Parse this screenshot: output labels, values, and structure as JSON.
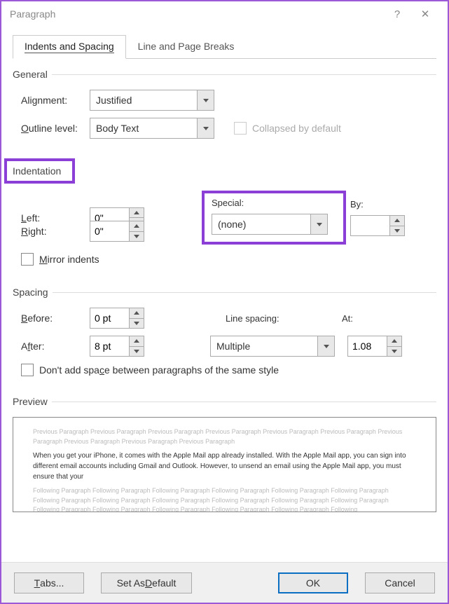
{
  "titlebar": {
    "title": "Paragraph",
    "help": "?",
    "close": "✕"
  },
  "tabs": {
    "t1": "Indents and Spacing",
    "t2": "Line and Page Breaks"
  },
  "general": {
    "title": "General",
    "alignment_label": "Alignment:",
    "alignment_value": "Justified",
    "outline_label": "Outline level:",
    "outline_value": "Body Text",
    "collapsed_label": "Collapsed by default"
  },
  "indentation": {
    "title": "Indentation",
    "left_label": "Left:",
    "left_value": "0\"",
    "right_label": "Right:",
    "right_value": "0\"",
    "special_label": "Special:",
    "special_value": "(none)",
    "by_label": "By:",
    "by_value": "",
    "mirror_label": "Mirror indents"
  },
  "spacing": {
    "title": "Spacing",
    "before_label": "Before:",
    "before_value": "0 pt",
    "after_label": "After:",
    "after_value": "8 pt",
    "line_label": "Line spacing:",
    "line_value": "Multiple",
    "at_label": "At:",
    "at_value": "1.08",
    "dont_add_label": "Don't add space between paragraphs of the same style"
  },
  "preview": {
    "title": "Preview",
    "prev_text": "Previous Paragraph Previous Paragraph Previous Paragraph Previous Paragraph Previous Paragraph Previous Paragraph Previous Paragraph Previous Paragraph Previous Paragraph Previous Paragraph",
    "body_text": "When you get your iPhone, it comes with the Apple Mail app already installed. With the Apple Mail app, you can sign into different email accounts including Gmail and Outlook. However, to unsend an email using the Apple Mail app, you must ensure that your",
    "next_text": "Following Paragraph Following Paragraph Following Paragraph Following Paragraph Following Paragraph Following Paragraph Following Paragraph Following Paragraph Following Paragraph Following Paragraph Following Paragraph Following Paragraph Following Paragraph Following Paragraph Following Paragraph Following Paragraph Following Paragraph Following"
  },
  "footer": {
    "tabs": "Tabs...",
    "default": "Set As Default",
    "ok": "OK",
    "cancel": "Cancel"
  }
}
